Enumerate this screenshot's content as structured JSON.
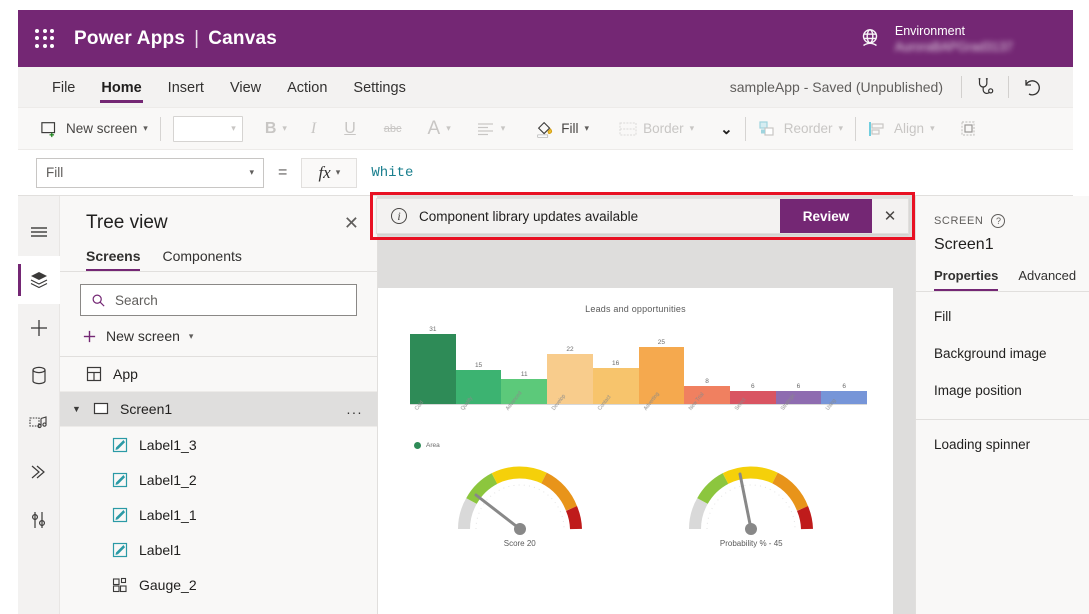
{
  "header": {
    "waffle_icon": "waffle-grid-icon",
    "product": "Power Apps",
    "divider": "|",
    "mode": "Canvas",
    "env_icon": "globe-icon",
    "env_label": "Environment",
    "env_name": "AuroraBAPGrad3137",
    "brand_color": "#742774"
  },
  "menubar": {
    "items": [
      {
        "label": "File",
        "active": false
      },
      {
        "label": "Home",
        "active": true
      },
      {
        "label": "Insert",
        "active": false
      },
      {
        "label": "View",
        "active": false
      },
      {
        "label": "Action",
        "active": false
      },
      {
        "label": "Settings",
        "active": false
      }
    ],
    "app_status": "sampleApp - Saved (Unpublished)",
    "checker_icon": "stethoscope-icon",
    "undo_icon": "undo-arrow-icon"
  },
  "toolbar": {
    "new_screen": "New screen",
    "new_screen_icon": "new-screen-icon",
    "font_family_value": "",
    "bold": "B",
    "italic": "I",
    "underline": "U",
    "strikethrough": "abc",
    "font_color_icon": "font-color-icon",
    "align_icon": "align-left-icon",
    "fill_icon": "fill-bucket-icon",
    "fill": "Fill",
    "border_icon": "border-icon",
    "border": "Border",
    "more_chevron": "chevron-down-icon",
    "reorder_icon": "reorder-icon",
    "reorder": "Reorder",
    "align_group_icon": "align-group-icon",
    "align": "Align",
    "group_icon": "group-objects-icon"
  },
  "formulabar": {
    "property": "Fill",
    "equals": "=",
    "fx_label": "fx",
    "value": "White",
    "value_color": "#1a7f8e"
  },
  "rail": {
    "items": [
      {
        "name": "hamburger-menu-icon",
        "selected": false
      },
      {
        "name": "tree-view-layers-icon",
        "selected": true
      },
      {
        "name": "insert-plus-icon",
        "selected": false
      },
      {
        "name": "data-database-icon",
        "selected": false
      },
      {
        "name": "media-icon",
        "selected": false
      },
      {
        "name": "power-automate-flows-icon",
        "selected": false
      },
      {
        "name": "variables-tools-icon",
        "selected": false
      }
    ]
  },
  "treeview": {
    "title": "Tree view",
    "close_icon": "close-icon",
    "tabs": [
      {
        "label": "Screens",
        "active": true
      },
      {
        "label": "Components",
        "active": false
      }
    ],
    "search_placeholder": "Search",
    "search_icon": "search-icon",
    "new_screen": "New screen",
    "new_screen_plus": "plus-icon",
    "items": [
      {
        "label": "App",
        "icon": "app-icon",
        "level": 0,
        "selected": false,
        "caret": "",
        "menu": ""
      },
      {
        "label": "Screen1",
        "icon": "screen-icon",
        "level": 0,
        "selected": true,
        "caret": "chevron-down-icon",
        "menu": "..."
      },
      {
        "label": "Label1_3",
        "icon": "label-icon",
        "level": 1,
        "selected": false,
        "caret": "",
        "menu": ""
      },
      {
        "label": "Label1_2",
        "icon": "label-icon",
        "level": 1,
        "selected": false,
        "caret": "",
        "menu": ""
      },
      {
        "label": "Label1_1",
        "icon": "label-icon",
        "level": 1,
        "selected": false,
        "caret": "",
        "menu": ""
      },
      {
        "label": "Label1",
        "icon": "label-icon",
        "level": 1,
        "selected": false,
        "caret": "",
        "menu": ""
      },
      {
        "label": "Gauge_2",
        "icon": "gauge-component-icon",
        "level": 1,
        "selected": false,
        "caret": "",
        "menu": ""
      }
    ]
  },
  "banner": {
    "info_icon": "info-circle-icon",
    "message": "Component library updates available",
    "review_label": "Review",
    "close_icon": "close-icon",
    "highlight_color": "#e81123",
    "button_color": "#742774"
  },
  "properties": {
    "kicker": "SCREEN",
    "help_icon": "help-circle-icon",
    "name": "Screen1",
    "tabs": [
      {
        "label": "Properties",
        "active": true
      },
      {
        "label": "Advanced",
        "active": false
      }
    ],
    "group1": [
      "Fill",
      "Background image",
      "Image position"
    ],
    "group2": [
      "Loading spinner"
    ]
  },
  "chart_data": [
    {
      "type": "bar",
      "title": "Leads and opportunities",
      "categories": [
        "Cold",
        "Qualify",
        "Advanced",
        "Develop",
        "Contact",
        "Adverting",
        "New Trial",
        "Select",
        "Strategic",
        "Using"
      ],
      "values": [
        31,
        15,
        11,
        22,
        16,
        25,
        8,
        6,
        6,
        6
      ],
      "colors": [
        "#2e8b57",
        "#3cb371",
        "#5cc97a",
        "#f8cc8c",
        "#f7c46c",
        "#f5a94e",
        "#f08060",
        "#d95462",
        "#8e6cb0",
        "#7695d8"
      ],
      "legend": [
        "Area"
      ],
      "legend_position": "bottom-left",
      "xlabel": "",
      "ylabel": "",
      "ylim": [
        0,
        31
      ],
      "grid": false
    },
    {
      "type": "gauge",
      "title": "Score",
      "label": "Score    20",
      "value": 20,
      "min": 0,
      "max": 100,
      "bands": [
        {
          "color": "#d9d9d9",
          "to": 10
        },
        {
          "color": "#8cc63e",
          "to": 30
        },
        {
          "color": "#f5d00a",
          "to": 55
        },
        {
          "color": "#e8941a",
          "to": 80
        },
        {
          "color": "#bf1b1b",
          "to": 100
        }
      ]
    },
    {
      "type": "gauge",
      "title": "Probability %",
      "label": "Probability % -  45",
      "value": 45,
      "min": 0,
      "max": 100,
      "bands": [
        {
          "color": "#d9d9d9",
          "to": 10
        },
        {
          "color": "#8cc63e",
          "to": 30
        },
        {
          "color": "#f5d00a",
          "to": 55
        },
        {
          "color": "#e8941a",
          "to": 80
        },
        {
          "color": "#bf1b1b",
          "to": 100
        }
      ]
    }
  ]
}
